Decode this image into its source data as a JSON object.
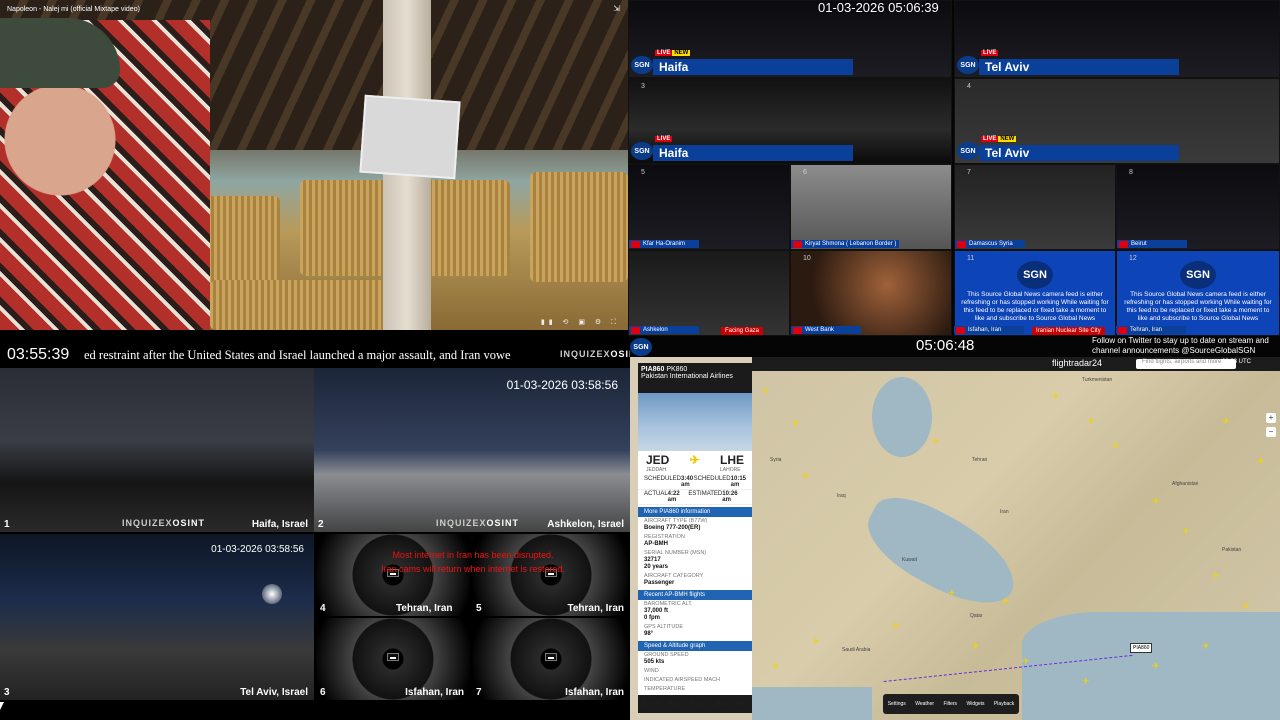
{
  "video": {
    "title": "Napoleon - Nalej mi (official Mixtape video)",
    "controls": "▮▮ ⟲ ▣ ⚙ ⛶"
  },
  "sgn": {
    "clock_top": "01-03-2026 05:06:39",
    "clock_bottom": "05:06:48",
    "live": "LIVE",
    "new": "NEW",
    "logo": "SGN",
    "cells": [
      {
        "idx": "1",
        "city": "Haifa"
      },
      {
        "idx": "2",
        "city": "Tel Aviv"
      },
      {
        "idx": "3",
        "city": "Haifa"
      },
      {
        "idx": "4",
        "city": "Tel Aviv"
      },
      {
        "idx": "5",
        "city": "Kfar Ha-Oranim"
      },
      {
        "idx": "6",
        "city": "Kiryat Shmona ( Lebanon Border )"
      },
      {
        "idx": "7",
        "city": "Damascus Syria"
      },
      {
        "idx": "8",
        "city": "Beirut"
      },
      {
        "idx": "9",
        "city": "Ashkelon"
      },
      {
        "idx": "10",
        "city": "West Bank"
      },
      {
        "idx": "11",
        "city": "Isfahan, Iran"
      },
      {
        "idx": "12",
        "city": "Tehran, Iran"
      }
    ],
    "gaza_tag": "Facing Gaza",
    "nuclear_tag": "Iranian Nuclear Site City",
    "card_text": "This Source Global News camera feed is either refreshing or has stopped working While waiting for this feed to be replaced or fixed take a moment to like and subscribe to Source Global News",
    "twitter": "Follow on Twitter to stay up to date on stream and channel announcements @SourceGlobalSGN"
  },
  "osint": {
    "clock": "03:55:39",
    "ticker": "ed restraint after the United States and Israel launched a major assault, and Iran vowe",
    "brand_a": "INQUIZEX",
    "brand_b": "OSINT",
    "cam1": {
      "n": "1",
      "label": "Haifa, Israel"
    },
    "cam2": {
      "n": "2",
      "label": "Ashkelon, Israel",
      "ts": "01-03-2026 03:58:56"
    },
    "cam3": {
      "n": "3",
      "label": "Tel Aviv, Israel",
      "ts": "01-03-2026 03:58:56"
    },
    "cam4": {
      "n": "4",
      "label": "Tehran, Iran"
    },
    "cam5": {
      "n": "5",
      "label": "Tehran, Iran"
    },
    "cam6": {
      "n": "6",
      "label": "Isfahan, Iran"
    },
    "cam7": {
      "n": "7",
      "label": "Isfahan, Iran"
    },
    "red_line1": "Most internet in Iran has been disrupted.",
    "red_line2": "Iran cams will return when internet is restored."
  },
  "fr24": {
    "logo": "flightradar24",
    "search_placeholder": "Find flights, airports and more",
    "time": "03:08 UTC",
    "flight": "PIA860",
    "flight_tag": "PK860",
    "airline": "Pakistan International Airlines",
    "origin": "JED",
    "origin_city": "JEDDAH",
    "dest": "LHE",
    "dest_city": "LAHORE",
    "rows": [
      {
        "k": "SCHEDULED",
        "v": "3:40 am",
        "k2": "SCHEDULED",
        "v2": "10:15 am"
      },
      {
        "k": "ACTUAL",
        "v": "4:22 am",
        "k2": "ESTIMATED",
        "v2": "10:26 am"
      }
    ],
    "more_info": "More PIA860 information",
    "aircraft_type_k": "AIRCRAFT TYPE (B77W)",
    "aircraft_type_v": "Boeing 777-200(ER)",
    "reg_k": "REGISTRATION",
    "reg_v": "AP-BMH",
    "serial_k": "SERIAL NUMBER (MSN)",
    "serial_v": "32717",
    "age_v": "20 years",
    "category_k": "AIRCRAFT CATEGORY",
    "category_v": "Passenger",
    "recent": "Recent AP-BMH flights",
    "baro_k": "BAROMETRIC ALT.",
    "baro_v": "37,000 ft",
    "gps_k": "GPS ALTITUDE",
    "vs_v": "0 fpm",
    "track_v": "98°",
    "speed": "Speed & Altitude graph",
    "gs_k": "GROUND SPEED",
    "gs_v": "505 kts",
    "wind_k": "WIND",
    "ias_k": "INDICATED AIRSPEED",
    "mach_k": "MACH",
    "temp_k": "TEMPERATURE",
    "foot": [
      "3D view",
      "Route",
      "Follow",
      "Share",
      "More"
    ],
    "bottom": [
      "Settings",
      "Weather",
      "Filters",
      "Widgets",
      "Playback"
    ],
    "tag": "PIA860",
    "labels": [
      "Syria",
      "Iraq",
      "Iran",
      "Turkmenistan",
      "Afghanistan",
      "Pakistan",
      "Saudi Arabia",
      "Kuwait",
      "Qatar",
      "Tehran"
    ]
  }
}
